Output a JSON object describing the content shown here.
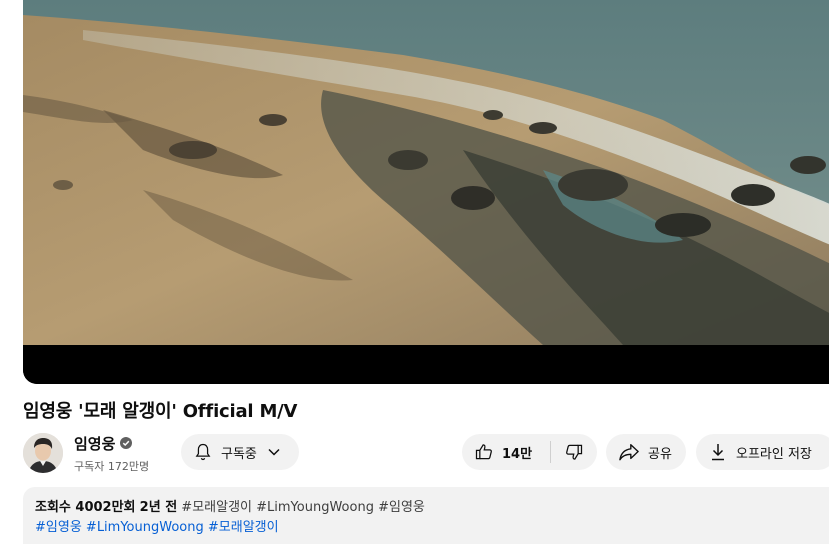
{
  "video": {
    "title": "임영웅 '모래 알갱이' Official M/V"
  },
  "channel": {
    "name": "임영웅",
    "subscribers": "구독자 172만명"
  },
  "actions": {
    "subscribe_label": "구독중",
    "like_count": "14만",
    "share_label": "공유",
    "download_label": "오프라인 저장"
  },
  "description": {
    "views": "조회수 4002만회",
    "age": "2년 전",
    "top_tags": [
      "#모래알갱이",
      "#LimYoungWoong",
      "#임영웅"
    ],
    "hashtags": [
      "#임영웅",
      "#LimYoungWoong",
      "#모래알갱이"
    ]
  },
  "icons": {
    "verified": "verified-badge-icon",
    "bell": "bell-icon",
    "chevron": "chevron-down-icon",
    "like": "thumbs-up-icon",
    "dislike": "thumbs-down-icon",
    "share": "share-arrow-icon",
    "download": "download-icon"
  },
  "colors": {
    "link": "#065fd4",
    "pill_bg": "#f2f2f2",
    "text": "#0f0f0f",
    "secondary_text": "#606060"
  }
}
